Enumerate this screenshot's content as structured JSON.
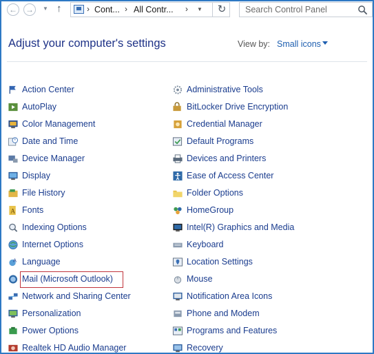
{
  "window": {
    "address_crumbs": [
      "Cont...",
      "All Contr..."
    ],
    "search_placeholder": "Search Control Panel"
  },
  "header": {
    "title": "Adjust your computer's settings",
    "view_by_label": "View by:",
    "view_by_value": "Small icons"
  },
  "left_items": [
    {
      "label": "Action Center",
      "icon": "flag-icon"
    },
    {
      "label": "AutoPlay",
      "icon": "autoplay-icon"
    },
    {
      "label": "Color Management",
      "icon": "color-management-icon"
    },
    {
      "label": "Date and Time",
      "icon": "clock-icon"
    },
    {
      "label": "Device Manager",
      "icon": "device-manager-icon"
    },
    {
      "label": "Display",
      "icon": "display-icon"
    },
    {
      "label": "File History",
      "icon": "file-history-icon"
    },
    {
      "label": "Fonts",
      "icon": "fonts-icon"
    },
    {
      "label": "Indexing Options",
      "icon": "indexing-icon"
    },
    {
      "label": "Internet Options",
      "icon": "globe-icon"
    },
    {
      "label": "Language",
      "icon": "language-icon"
    },
    {
      "label": "Mail (Microsoft Outlook)",
      "icon": "mail-icon"
    },
    {
      "label": "Network and Sharing Center",
      "icon": "network-icon"
    },
    {
      "label": "Personalization",
      "icon": "personalization-icon"
    },
    {
      "label": "Power Options",
      "icon": "power-icon"
    },
    {
      "label": "Realtek HD Audio Manager",
      "icon": "audio-icon"
    }
  ],
  "right_items": [
    {
      "label": "Administrative Tools",
      "icon": "admin-tools-icon"
    },
    {
      "label": "BitLocker Drive Encryption",
      "icon": "bitlocker-icon"
    },
    {
      "label": "Credential Manager",
      "icon": "credential-icon"
    },
    {
      "label": "Default Programs",
      "icon": "default-programs-icon"
    },
    {
      "label": "Devices and Printers",
      "icon": "printer-icon"
    },
    {
      "label": "Ease of Access Center",
      "icon": "ease-of-access-icon"
    },
    {
      "label": "Folder Options",
      "icon": "folder-icon"
    },
    {
      "label": "HomeGroup",
      "icon": "homegroup-icon"
    },
    {
      "label": "Intel(R) Graphics and Media",
      "icon": "intel-graphics-icon"
    },
    {
      "label": "Keyboard",
      "icon": "keyboard-icon"
    },
    {
      "label": "Location Settings",
      "icon": "location-icon"
    },
    {
      "label": "Mouse",
      "icon": "mouse-icon"
    },
    {
      "label": "Notification Area Icons",
      "icon": "notification-icon"
    },
    {
      "label": "Phone and Modem",
      "icon": "phone-icon"
    },
    {
      "label": "Programs and Features",
      "icon": "programs-icon"
    },
    {
      "label": "Recovery",
      "icon": "recovery-icon"
    }
  ],
  "colors": {
    "link": "#1a3c8e",
    "title": "#1e3287",
    "highlight": "#c0333a",
    "frame": "#2e79c4"
  }
}
